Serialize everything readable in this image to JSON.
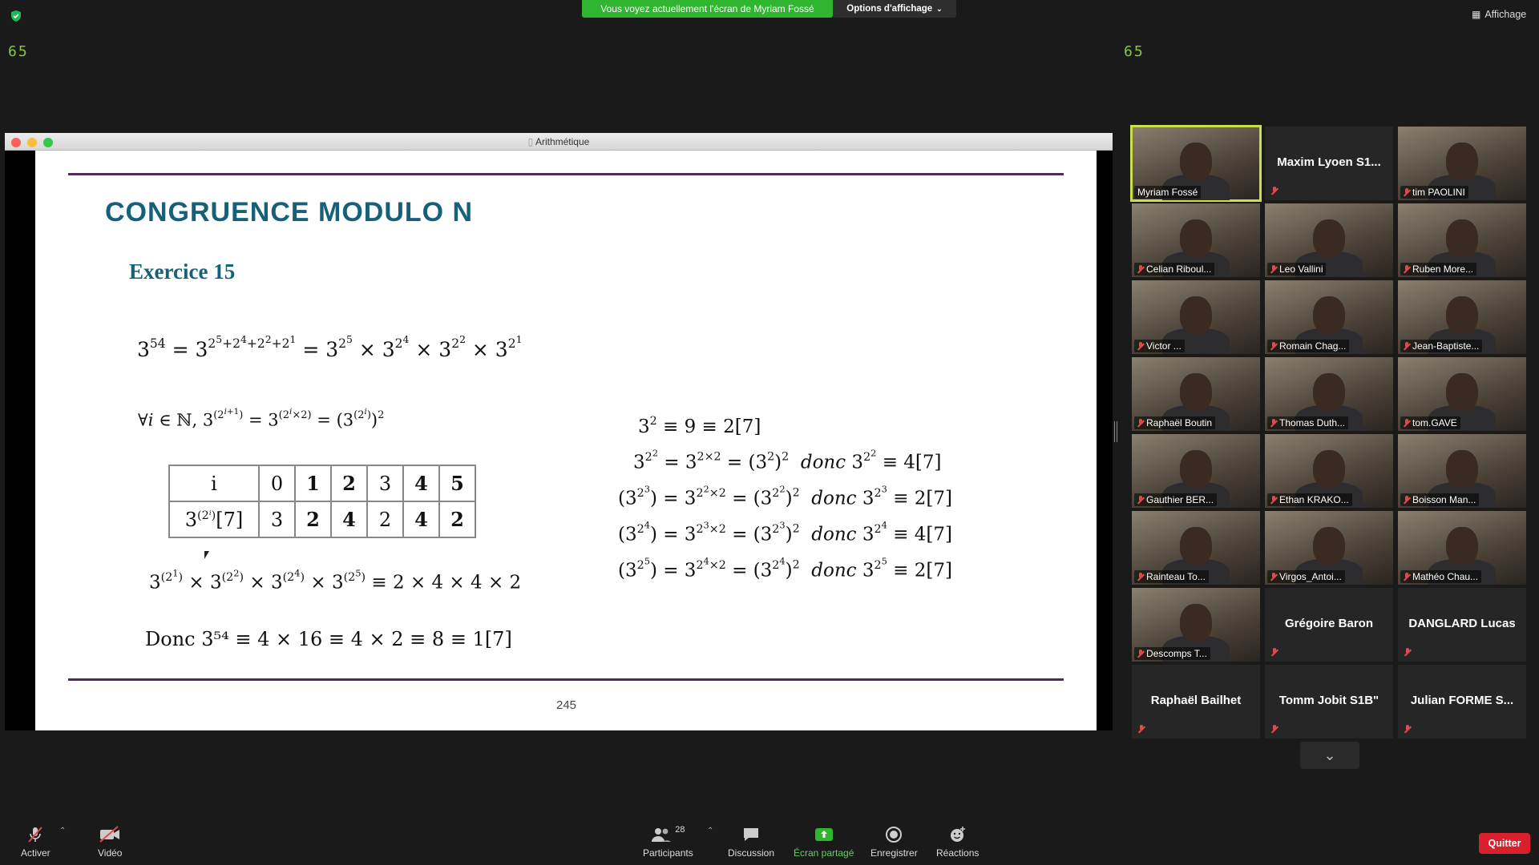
{
  "top": {
    "banner": "Vous voyez actuellement l'écran de Myriam Fossé",
    "view_options": "Options d'affichage",
    "affichage": "Affichage",
    "counter_left": "65",
    "counter_right": "65"
  },
  "window": {
    "title": "Arithmétique"
  },
  "slide": {
    "title": "CONGRUENCE MODULO N",
    "exercise": "Exercice 15",
    "page_number": "245",
    "table": {
      "header_label": "i",
      "header_values": [
        "0",
        "1",
        "2",
        "3",
        "4",
        "5"
      ],
      "row_label": "3(2i)[7]",
      "row_values": [
        "3",
        "2",
        "4",
        "2",
        "4",
        "2"
      ]
    },
    "conclusion": "Donc 3⁵⁴ ≡ 4 × 16 ≡ 4 × 2 ≡ 8 ≡ 1[7]"
  },
  "participants": [
    {
      "name": "Myriam Fossé",
      "video": true,
      "active": true,
      "muted": false
    },
    {
      "name": "Maxim  Lyoen S1...",
      "video": false,
      "muted": true
    },
    {
      "name": "tim PAOLINI",
      "video": true,
      "muted": true
    },
    {
      "name": "Celian Riboul...",
      "video": true,
      "muted": true
    },
    {
      "name": "Leo Vallini",
      "video": true,
      "muted": true
    },
    {
      "name": "Ruben More...",
      "video": true,
      "muted": true
    },
    {
      "name": "Victor ...",
      "video": true,
      "muted": true
    },
    {
      "name": "Romain Chag...",
      "video": true,
      "muted": true
    },
    {
      "name": "Jean-Baptiste...",
      "video": true,
      "muted": true
    },
    {
      "name": "Raphaël Boutin",
      "video": true,
      "muted": true
    },
    {
      "name": "Thomas Duth...",
      "video": true,
      "muted": true
    },
    {
      "name": "tom.GAVE",
      "video": true,
      "muted": true
    },
    {
      "name": "Gauthier BER...",
      "video": true,
      "muted": true
    },
    {
      "name": "Ethan KRAKO...",
      "video": true,
      "muted": true
    },
    {
      "name": "Boisson Man...",
      "video": true,
      "muted": true
    },
    {
      "name": "Rainteau To...",
      "video": true,
      "muted": true
    },
    {
      "name": "Virgos_Antoi...",
      "video": true,
      "muted": true
    },
    {
      "name": "Mathéo Chau...",
      "video": true,
      "muted": true
    },
    {
      "name": "Descomps T...",
      "video": true,
      "muted": true
    },
    {
      "name": "Grégoire Baron",
      "video": false,
      "muted": true
    },
    {
      "name": "DANGLARD Lucas",
      "video": false,
      "muted": true
    },
    {
      "name": "Raphaël Bailhet",
      "video": false,
      "muted": true
    },
    {
      "name": "Tomm Jobit S1B\"",
      "video": false,
      "muted": true
    },
    {
      "name": "Julian FORME S...",
      "video": false,
      "muted": true
    }
  ],
  "toolbar": {
    "mute": "Activer",
    "video": "Vidéo",
    "participants": "Participants",
    "participants_count": "28",
    "chat": "Discussion",
    "share": "Écran partagé",
    "record": "Enregistrer",
    "reactions": "Réactions",
    "quit": "Quitter"
  },
  "colors": {
    "accent_green": "#2fb52f",
    "slide_title": "#17607a",
    "rule": "#4a2c55",
    "quit": "#d9202c"
  }
}
